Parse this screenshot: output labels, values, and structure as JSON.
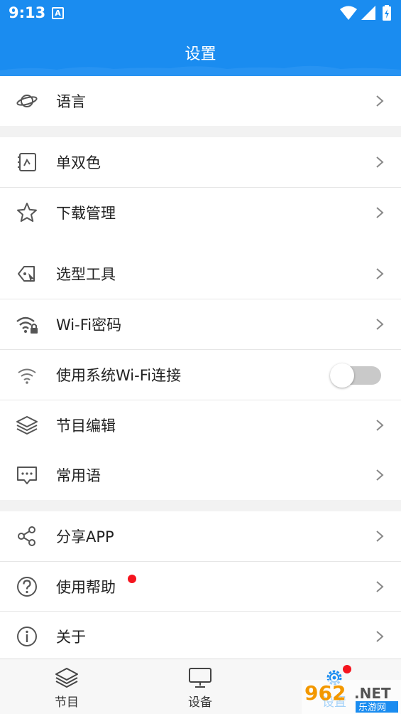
{
  "status_bar": {
    "time": "9:13",
    "notification_icon": "A"
  },
  "app_bar": {
    "title": "设置"
  },
  "menu": {
    "language": "语言",
    "mono_dual_color": "单双色",
    "download_management": "下载管理",
    "selection_tool": "选型工具",
    "wifi_password": "Wi-Fi密码",
    "use_system_wifi": "使用系统Wi-Fi连接",
    "program_edit": "节目编辑",
    "common_phrases": "常用语",
    "share_app": "分享APP",
    "help": "使用帮助",
    "about": "关于"
  },
  "toggle_system_wifi": {
    "on": false
  },
  "tab_bar": {
    "programs": "节目",
    "devices": "设备",
    "settings": "设置"
  },
  "watermark": {
    "number": "962",
    "suffix": ".NET",
    "sub": "乐游网"
  },
  "colors": {
    "brand": "#1a8cf0",
    "badge": "#f5141e"
  }
}
